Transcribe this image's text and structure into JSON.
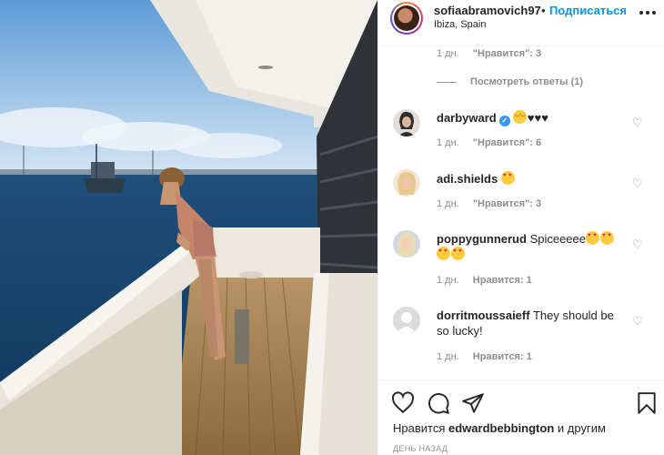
{
  "header": {
    "username": "sofiaabramovich97",
    "dot": "•",
    "follow_label": "Подписаться",
    "location": "Ibiza, Spain"
  },
  "comments": {
    "top_meta": {
      "time": "1 дн.",
      "likes": "\"Нравится\": 3"
    },
    "view_replies": "Посмотреть ответы (1)",
    "items": [
      {
        "user": "darbyward",
        "verified": true,
        "text": "😂♥♥♥",
        "time": "1 дн.",
        "likes": "\"Нравится\": 6"
      },
      {
        "user": "adi.shields",
        "verified": false,
        "text": "😍",
        "time": "1 дн.",
        "likes": "\"Нравится\": 3"
      },
      {
        "user": "poppygunnerud",
        "verified": false,
        "text": "Spiceeeee😍😍😍😍",
        "text_plain": "Spiceeeee",
        "time": "1 дн.",
        "likes": "Нравится: 1"
      },
      {
        "user": "dorritmoussaieff",
        "verified": false,
        "text": "They should be so lucky!",
        "time": "1 дн.",
        "likes": "Нравится: 1"
      }
    ]
  },
  "actions": {
    "liked_prefix": "Нравится",
    "liked_user": "edwardbebbington",
    "liked_suffix": "и другим",
    "date": "ДЕНЬ НАЗАД"
  },
  "icons": {
    "like": "heart-outline-icon",
    "comment": "comment-bubble-icon",
    "share": "paper-plane-icon",
    "save": "bookmark-icon",
    "more": "more-horizontal-icon",
    "comment_like": "heart-small-icon"
  },
  "colors": {
    "link_blue": "#0095f6",
    "text": "#262626",
    "secondary_text": "#8e8e8e",
    "verified_blue": "#3897f0"
  }
}
